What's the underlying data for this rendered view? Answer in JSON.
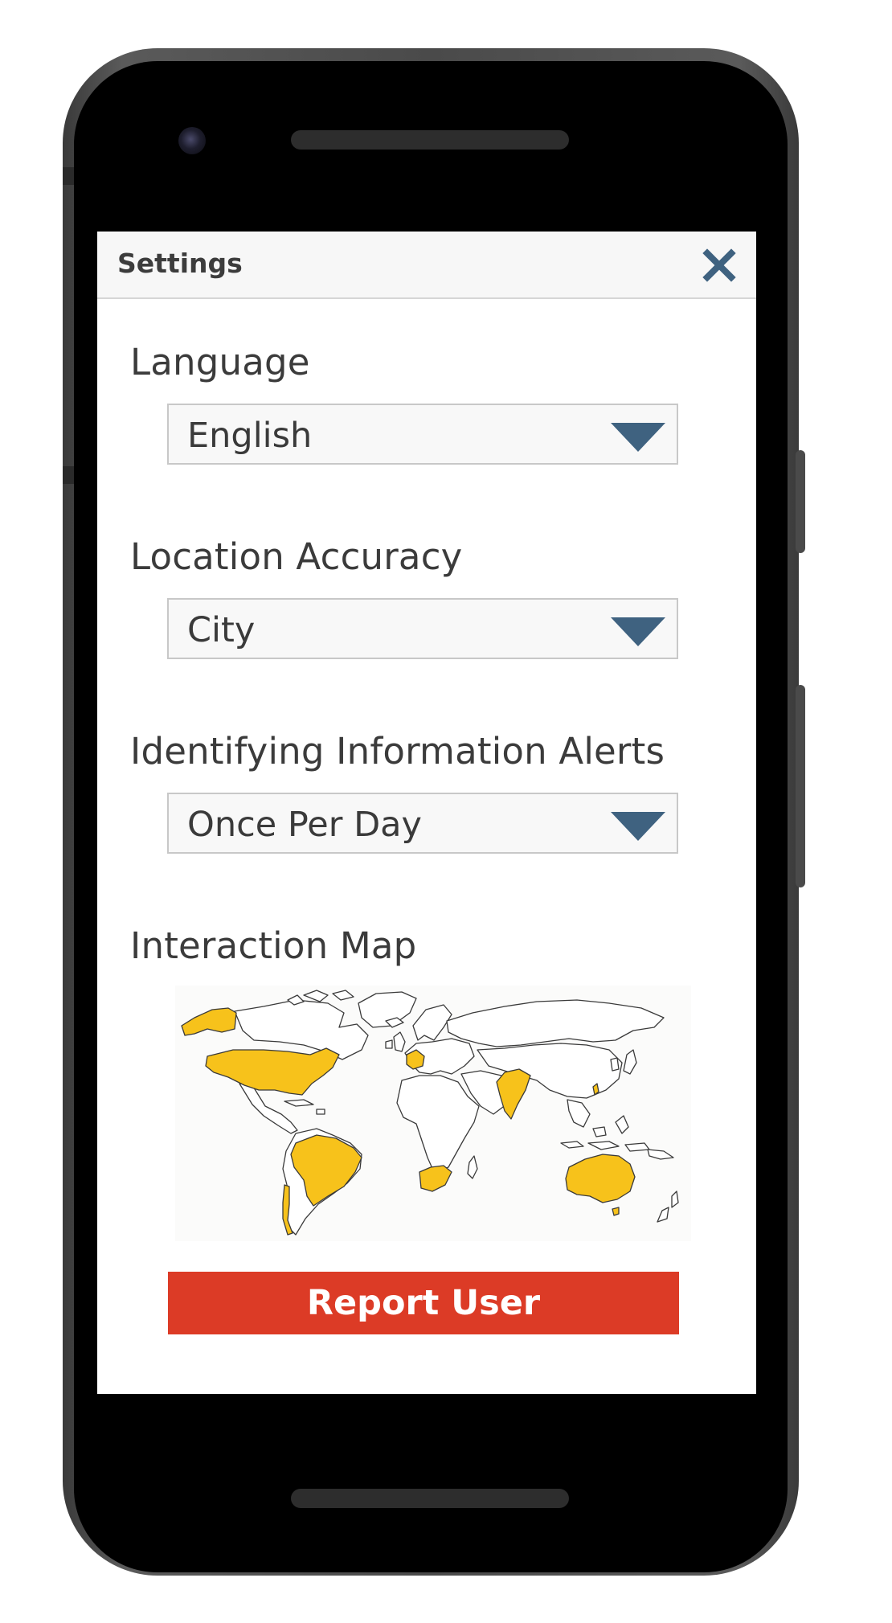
{
  "settings": {
    "title": "Settings",
    "close_icon": "close-x-icon",
    "accent_color": "#3f6280",
    "language": {
      "label": "Language",
      "selected": "English"
    },
    "location_accuracy": {
      "label": "Location Accuracy",
      "selected": "City"
    },
    "id_alerts": {
      "label": "Identifying Information Alerts",
      "selected": "Once Per Day"
    },
    "interaction_map": {
      "label": "Interaction Map",
      "highlight_color": "#f7c21b",
      "highlighted_regions": [
        "Alaska",
        "United States",
        "France",
        "India",
        "Brazil",
        "Chile",
        "South Africa",
        "Australia",
        "Taiwan"
      ]
    },
    "report_button": {
      "label": "Report User",
      "color": "#dc3b26"
    }
  }
}
